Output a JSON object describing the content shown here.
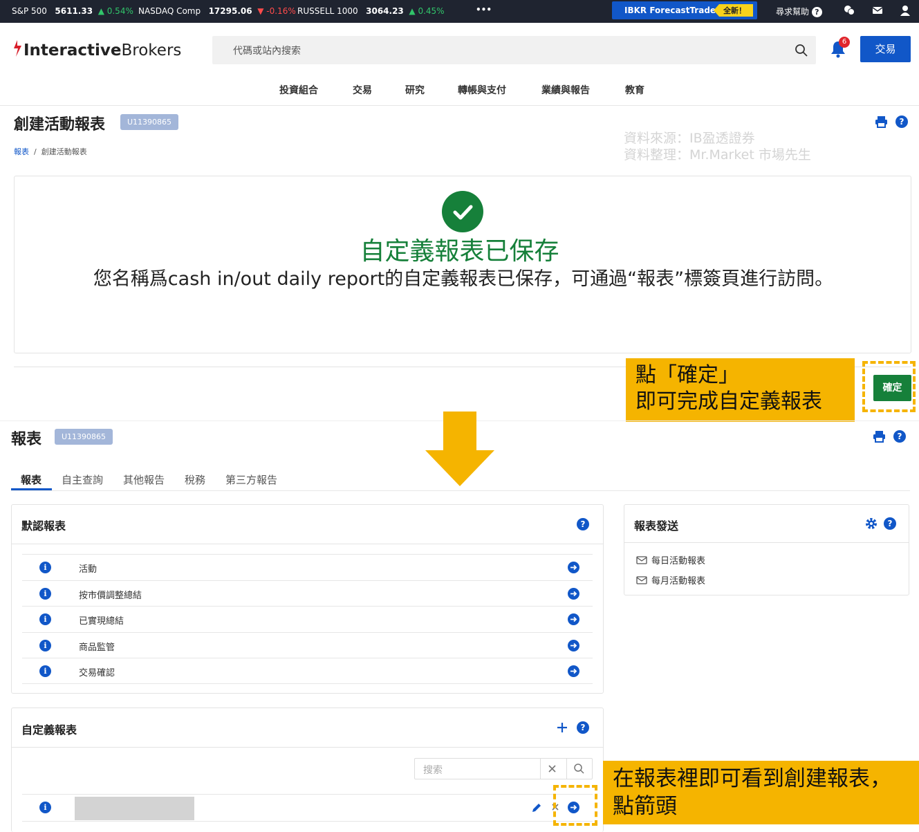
{
  "ticker": [
    {
      "name": "S&P 500",
      "value": "5611.33",
      "change": "▲ 0.54%",
      "dir": "up"
    },
    {
      "name": "NASDAQ Comp",
      "value": "17295.06",
      "change": "▼ -0.16%",
      "dir": "dn"
    },
    {
      "name": "RUSSELL 1000",
      "value": "3064.23",
      "change": "▲ 0.45%",
      "dir": "up"
    }
  ],
  "ticker_more": "•••",
  "forecast": {
    "label": "IBKR ForecastTrader",
    "tag": "全新！"
  },
  "help_label": "尋求幫助",
  "logo": {
    "part1": "Interactive",
    "part2": "Brokers"
  },
  "search_placeholder": "代碼或站內搜索",
  "notifications": "6",
  "trade_button": "交易",
  "nav": [
    "投資組合",
    "交易",
    "研究",
    "轉帳與支付",
    "業績與報告",
    "教育"
  ],
  "page1": {
    "title": "創建活動報表",
    "account": "U11390865",
    "breadcrumb": {
      "root": "報表",
      "sep": "/",
      "current": "創建活動報表"
    }
  },
  "watermark": {
    "line1": "資料來源：IB盈透證券",
    "line2": "資料整理：Mr.Market 市場先生"
  },
  "saved": {
    "title": "自定義報表已保存",
    "message": "您名稱爲cash in/out daily report的自定義報表已保存，可通過“報表”標簽頁進行訪問。"
  },
  "note1": {
    "line1": "點「確定」",
    "line2": "即可完成自定義報表"
  },
  "confirm_button": "確定",
  "page2": {
    "title": "報表",
    "account": "U11390865"
  },
  "tabs": [
    "報表",
    "自主查詢",
    "其他報告",
    "稅務",
    "第三方報告"
  ],
  "default_reports": {
    "title": "默認報表",
    "items": [
      "活動",
      "按市價調整總結",
      "已實現總結",
      "商品監管",
      "交易確認"
    ]
  },
  "delivery": {
    "title": "報表發送",
    "items": [
      "每日活動報表",
      "每月活動報表"
    ]
  },
  "custom_reports": {
    "title": "自定義報表",
    "search_placeholder": "搜索"
  },
  "note2": {
    "line1": "在報表裡即可看到創建報表，",
    "line2": "點箭頭"
  },
  "colors": {
    "brand_blue": "#1157c8",
    "success_green": "#16803a",
    "highlight_yellow": "#f5b400",
    "ticker_bg": "#1f2430"
  }
}
